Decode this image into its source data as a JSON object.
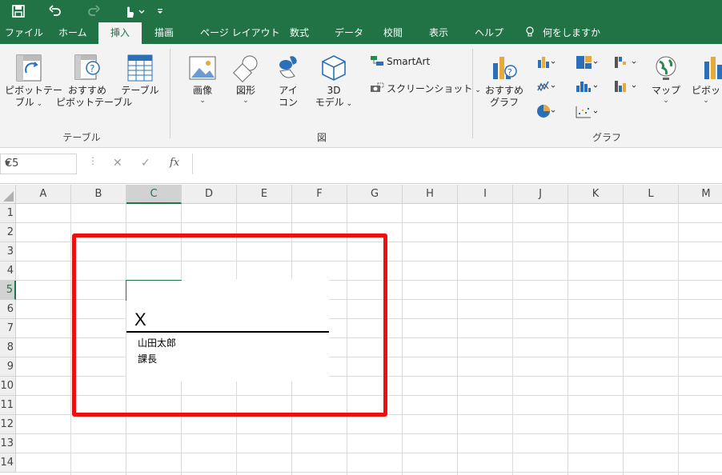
{
  "ribbon_tabs": [
    "ファイル",
    "ホーム",
    "挿入",
    "描画",
    "ページ レイアウト",
    "数式",
    "データ",
    "校閲",
    "表示",
    "ヘルプ"
  ],
  "active_tab": "挿入",
  "tell_me": "何をしますか",
  "groups": {
    "table": {
      "label": "テーブル",
      "pivot_table": [
        "ピボットテー",
        "ブル"
      ],
      "recommended_pivot": [
        "おすすめ",
        "ピボットテーブル"
      ],
      "table": "テーブル"
    },
    "illustrations": {
      "label": "図",
      "picture": "画像",
      "shapes": "図形",
      "icons": [
        "アイ",
        "コン"
      ],
      "models_3d": [
        "3D",
        "モデル"
      ],
      "smartart": "SmartArt",
      "screenshot": "スクリーンショット"
    },
    "charts": {
      "label": "グラフ",
      "recommended": [
        "おすすめ",
        "グラフ"
      ],
      "map": "マップ",
      "pivot_chart": "ピボットグ"
    }
  },
  "name_box": "C5",
  "formula_fx": "fx",
  "columns": [
    "A",
    "B",
    "C",
    "D",
    "E",
    "F",
    "G",
    "H",
    "I",
    "J",
    "K",
    "L",
    "M"
  ],
  "selected_column": "C",
  "rows": [
    "1",
    "2",
    "3",
    "4",
    "5",
    "6",
    "7",
    "8",
    "9",
    "10",
    "11",
    "12",
    "13",
    "14"
  ],
  "selected_row": "5",
  "signature": {
    "x_mark": "X",
    "name": "山田太郎",
    "title": "課長"
  },
  "colors": {
    "excel_green": "#217346",
    "highlight_red": "#ec1010"
  }
}
